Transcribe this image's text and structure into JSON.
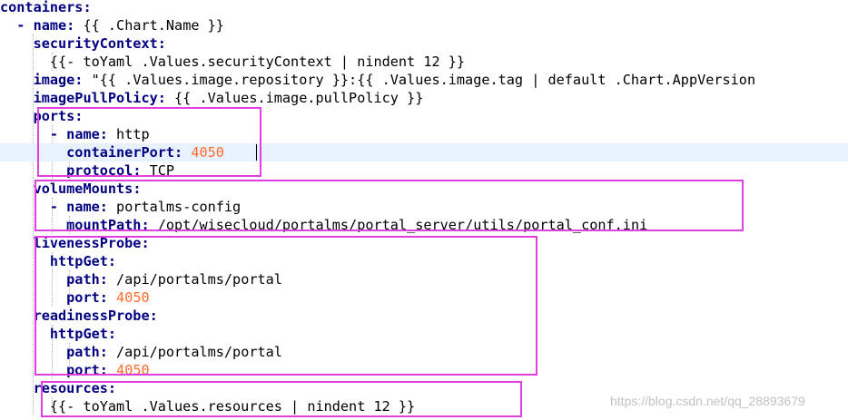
{
  "editor": {
    "lines": [
      {
        "indent": "",
        "dash": "",
        "key": "containers",
        "rest": ""
      },
      {
        "indent": "  ",
        "dash": "- ",
        "key": "name",
        "rest": " {{ .Chart.Name }}"
      },
      {
        "indent": "    ",
        "dash": "",
        "key": "securityContext",
        "rest": ""
      },
      {
        "indent": "      ",
        "dash": "",
        "key": "",
        "rest": "{{- toYaml .Values.securityContext | nindent 12 }}"
      },
      {
        "indent": "    ",
        "dash": "",
        "key": "image",
        "rest": " \"{{ .Values.image.repository }}:{{ .Values.image.tag | default .Chart.AppVersion"
      },
      {
        "indent": "    ",
        "dash": "",
        "key": "imagePullPolicy",
        "rest": " {{ .Values.image.pullPolicy }}"
      },
      {
        "indent": "    ",
        "dash": "",
        "key": "ports",
        "rest": ""
      },
      {
        "indent": "      ",
        "dash": "- ",
        "key": "name",
        "rest": " http"
      },
      {
        "indent": "        ",
        "dash": "",
        "key": "containerPort",
        "rest": "",
        "num": "4050"
      },
      {
        "indent": "        ",
        "dash": "",
        "key": "protocol",
        "rest": " TCP"
      },
      {
        "indent": "    ",
        "dash": "",
        "key": "volumeMounts",
        "rest": ""
      },
      {
        "indent": "      ",
        "dash": "- ",
        "key": "name",
        "rest": " portalms-config"
      },
      {
        "indent": "        ",
        "dash": "",
        "key": "mountPath",
        "rest": " /opt/wisecloud/portalms/portal_server/utils/portal_conf.ini"
      },
      {
        "indent": "    ",
        "dash": "",
        "key": "livenessProbe",
        "rest": ""
      },
      {
        "indent": "      ",
        "dash": "",
        "key": "httpGet",
        "rest": ""
      },
      {
        "indent": "        ",
        "dash": "",
        "key": "path",
        "rest": " /api/portalms/portal"
      },
      {
        "indent": "        ",
        "dash": "",
        "key": "port",
        "rest": "",
        "num": "4050"
      },
      {
        "indent": "    ",
        "dash": "",
        "key": "readinessProbe",
        "rest": ""
      },
      {
        "indent": "      ",
        "dash": "",
        "key": "httpGet",
        "rest": ""
      },
      {
        "indent": "        ",
        "dash": "",
        "key": "path",
        "rest": " /api/portalms/portal"
      },
      {
        "indent": "        ",
        "dash": "",
        "key": "port",
        "rest": "",
        "num": "4050"
      },
      {
        "indent": "    ",
        "dash": "",
        "key": "resources",
        "rest": ""
      },
      {
        "indent": "      ",
        "dash": "",
        "key": "",
        "rest": "{{- toYaml .Values.resources | nindent 12 }}"
      }
    ],
    "current_line": 8
  },
  "watermark": "https://blog.csdn.net/qq_28893679",
  "colors": {
    "key": "#000080",
    "number": "#ff6a2b",
    "highlight_box": "#e040e0",
    "current_line": "#e8f2fe"
  }
}
